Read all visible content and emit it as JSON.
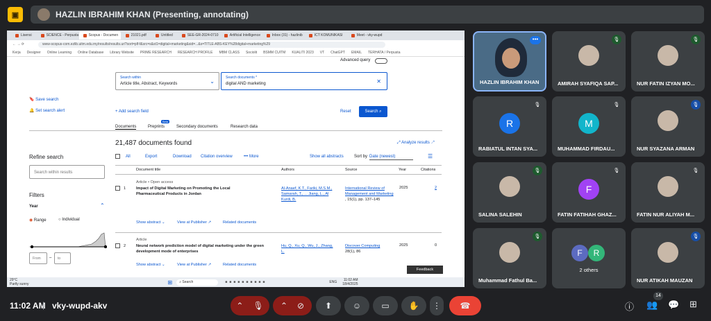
{
  "meet": {
    "presenter_banner": "HAZLIN IBRAHIM KHAN (Presenting, annotating)",
    "time": "11:02 AM",
    "separator": "|",
    "meeting_code": "vky-wupd-akv",
    "people_count": "14",
    "tiles": [
      {
        "name": "HAZLIN IBRAHIM KHAN",
        "kind": "video"
      },
      {
        "name": "AMIRAH SYAFIQA SAP...",
        "kind": "avatar",
        "mic": "muted-green"
      },
      {
        "name": "NUR FATIN IZYAN MO...",
        "kind": "avatar",
        "mic": "muted-green"
      },
      {
        "name": "RABIATUL INTAN SYA...",
        "kind": "letter",
        "letter": "R",
        "color": "#1a73e8",
        "mic": "muted"
      },
      {
        "name": "MUHAMMAD FIRDAU...",
        "kind": "letter",
        "letter": "M",
        "color": "#12b5cb",
        "mic": "muted"
      },
      {
        "name": "NUR SYAZANA ARMAN",
        "kind": "avatar",
        "mic": "muted-blue"
      },
      {
        "name": "SALINA SALEHIN",
        "kind": "avatar",
        "mic": "muted-green"
      },
      {
        "name": "FATIN FATIHAH GHAZ...",
        "kind": "letter",
        "letter": "F",
        "color": "#a142f4",
        "mic": "muted"
      },
      {
        "name": "FATIN NUR ALIYAH M...",
        "kind": "avatar",
        "mic": "muted"
      },
      {
        "name": "Muhammad Fathul Ba...",
        "kind": "avatar",
        "mic": "muted-green"
      },
      {
        "name": "2 others",
        "kind": "group",
        "letters": [
          "F",
          "R"
        ]
      },
      {
        "name": "NUR ATIKAH MAUZAN",
        "kind": "avatar",
        "mic": "muted-blue"
      }
    ],
    "feedback_label": "Feedback"
  },
  "browser": {
    "tabs": [
      "Lisensi",
      "SCIENCE - Perpusta",
      "Scopus - Documen",
      "21021.pdf",
      "Untitled",
      "SEE-GR-2024-0710",
      "Artificial Intelligence",
      "Inbox (31) - hazlinib",
      "ICT KOMUNIKASI",
      "Meet - vky-wupd"
    ],
    "url": "www-scopus-com.ezlib.uitm.edu.my/results/results.uri?sort=plf-f&src=s&st1=digital+marketing&sid=...&s=TITLE-ABS-KEY%28digital+marketing%29",
    "bookmarks": [
      "Kerja",
      "Designer",
      "Online Learning",
      "Online Database",
      "Library Website",
      "PRIME RESEARCH",
      "RESEARCH PROFILE",
      "MBM CLASS",
      "Sociolit",
      "BSMM CUITM",
      "KUALITI 2023",
      "VT",
      "ChatGPT",
      "EMAIL",
      "TERHATA / Perpusta"
    ]
  },
  "scopus": {
    "advanced_query": "Advanced query",
    "search_within_label": "Search within",
    "search_within_value": "Article title, Abstract, Keywords",
    "search_documents_label": "Search documents *",
    "search_documents_value": "digital AND marketing",
    "save_search": "Save search",
    "set_alert": "Set search alert",
    "add_field": "+ Add search field",
    "reset": "Reset",
    "search_button": "Search",
    "tabs": [
      "Documents",
      "Preprints",
      "Secondary documents",
      "Research data"
    ],
    "beta": "Beta",
    "count": "21,487 documents found",
    "analyze": "Analyze results",
    "refine": "Refine search",
    "search_within_results": "Search within results",
    "filters": "Filters",
    "year": "Year",
    "range": "Range",
    "individual": "Individual",
    "from": "From",
    "to": "to",
    "dash": "–",
    "toolbar": {
      "all": "All",
      "export": "Export",
      "download": "Download",
      "citation": "Citation overview",
      "more": "More",
      "show_abstracts": "Show all abstracts",
      "sort_by": "Sort by",
      "sort_value": "Date (newest)"
    },
    "columns": [
      "Document title",
      "Authors",
      "Source",
      "Year",
      "Citations"
    ],
    "results": [
      {
        "num": "1",
        "type": "Article • Open access",
        "title": "Impact of Digital Marketing on Promoting the Local Pharmaceutical Products in Jordan",
        "authors": "Al-Anaef, K.T., Fariki, M.S.M., Samarah, T., ... Jiang, L., Al Kurdi, B.",
        "source": "International Review of Management and Marketing",
        "source_detail": ", 15(1), pp. 137–145",
        "year": "2025",
        "cites": "2"
      },
      {
        "num": "2",
        "type": "Article",
        "title": "Neural network prediction model of digital marketing under the green development mode of enterprises",
        "authors": "Hu, Q., Xu, Q., Wu, J., Zhang, L.",
        "source": "Discover Computing",
        "source_detail": "28(1), 86",
        "year": "2025",
        "cites": "0"
      }
    ],
    "show_abstract": "Show abstract",
    "view_publisher": "View at Publisher",
    "related": "Related documents"
  },
  "taskbar": {
    "weather": "29°C",
    "weather_sub": "Partly sunny",
    "search": "Search",
    "lang": "ENG",
    "time": "11:02 AM",
    "date": "18/4/2025"
  }
}
